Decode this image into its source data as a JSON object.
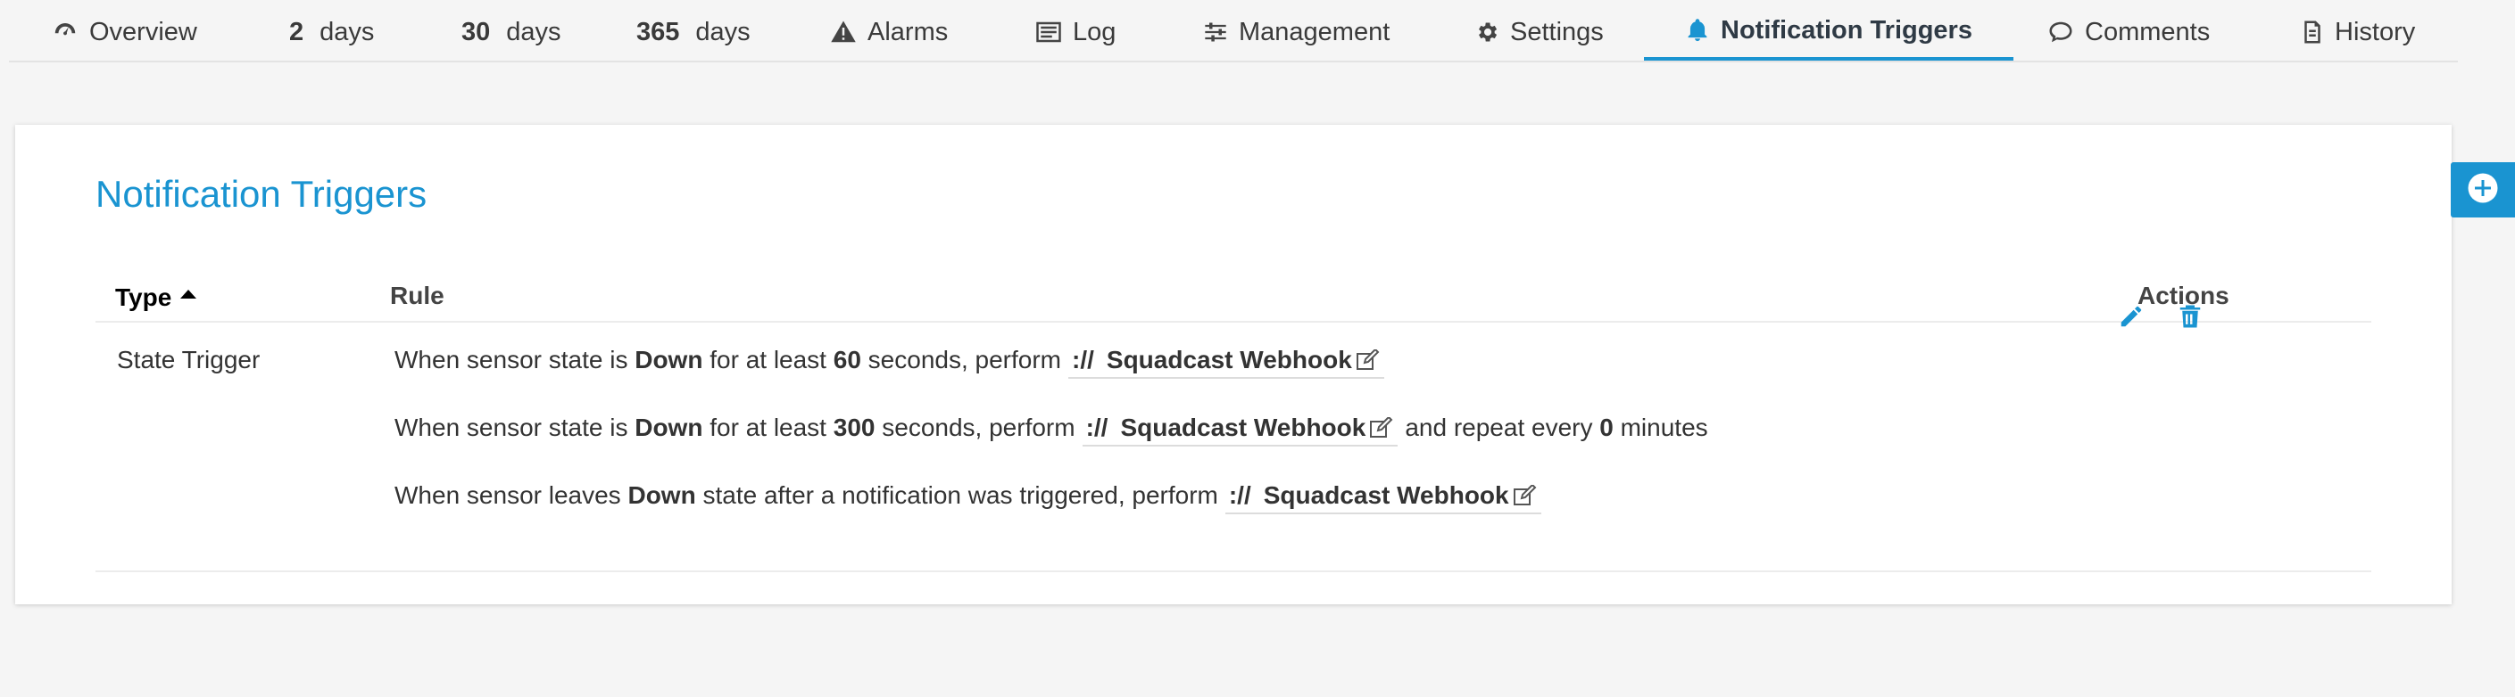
{
  "tabs": [
    {
      "id": "overview",
      "label": "Overview",
      "icon": "gauge-icon"
    },
    {
      "id": "2days",
      "num": "2",
      "label": "days"
    },
    {
      "id": "30days",
      "num": "30",
      "label": "days"
    },
    {
      "id": "365days",
      "num": "365",
      "label": "days"
    },
    {
      "id": "alarms",
      "label": "Alarms",
      "icon": "warning-icon"
    },
    {
      "id": "log",
      "label": "Log",
      "icon": "log-icon"
    },
    {
      "id": "management",
      "label": "Management",
      "icon": "sliders-icon"
    },
    {
      "id": "settings",
      "label": "Settings",
      "icon": "gear-icon"
    },
    {
      "id": "notification_triggers",
      "label": "Notification Triggers",
      "icon": "bell-icon",
      "active": true
    },
    {
      "id": "comments",
      "label": "Comments",
      "icon": "comment-icon"
    },
    {
      "id": "history",
      "label": "History",
      "icon": "history-icon"
    }
  ],
  "card": {
    "title": "Notification Triggers",
    "columns": {
      "type": "Type",
      "rule": "Rule",
      "actions": "Actions"
    },
    "sort": {
      "column": "type",
      "direction": "ascending"
    }
  },
  "triggers": [
    {
      "type": "State Trigger",
      "rules": [
        {
          "pre": "When sensor state is ",
          "state": "Down",
          "mid1": " for at least ",
          "seconds": "60",
          "mid2": " seconds, perform",
          "notification": {
            "protocol": "://",
            "name": "Squadcast Webhook"
          }
        },
        {
          "pre": "When sensor state is ",
          "state": "Down",
          "mid1": " for at least ",
          "seconds": "300",
          "mid2": " seconds, perform",
          "notification": {
            "protocol": "://",
            "name": "Squadcast Webhook"
          },
          "post": "and repeat every ",
          "repeat": "0",
          "post2": " minutes"
        },
        {
          "pre": "When sensor leaves ",
          "state": "Down",
          "mid1": " state after a notification was triggered, perform",
          "notification": {
            "protocol": "://",
            "name": "Squadcast Webhook"
          }
        }
      ]
    }
  ],
  "actions": [
    "pencil-icon",
    "trash-icon"
  ],
  "side_button": {
    "icon": "plus-circle-icon"
  },
  "colors": {
    "accent": "#1a94d1",
    "text": "#333333",
    "background": "#f5f5f5"
  }
}
